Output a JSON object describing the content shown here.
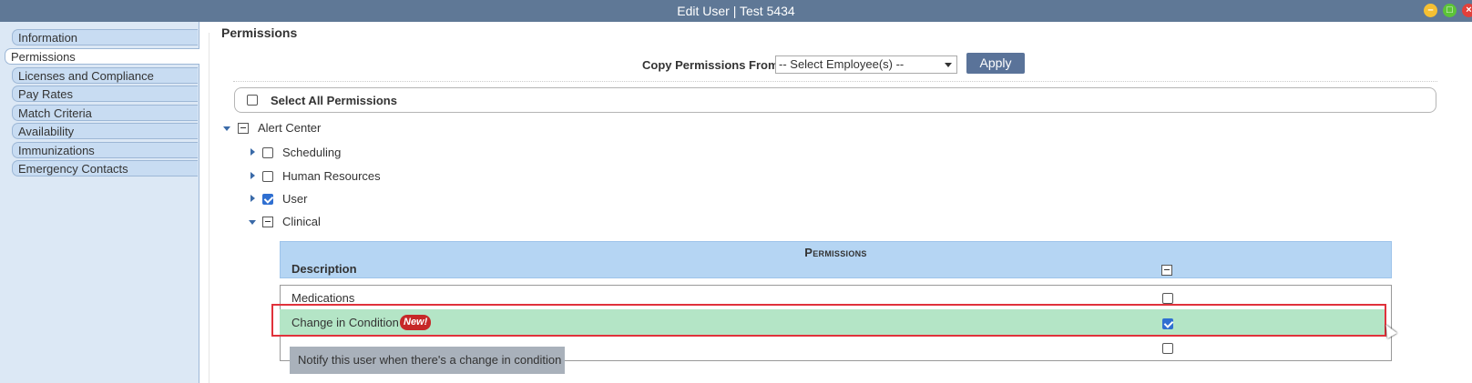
{
  "window": {
    "title": "Edit User | Test 5434"
  },
  "sidebar": {
    "items": [
      {
        "label": "Information"
      },
      {
        "label": "Permissions"
      },
      {
        "label": "Licenses and Compliance"
      },
      {
        "label": "Pay Rates"
      },
      {
        "label": "Match Criteria"
      },
      {
        "label": "Availability"
      },
      {
        "label": "Immunizations"
      },
      {
        "label": "Emergency Contacts"
      }
    ],
    "active": "Permissions"
  },
  "main": {
    "section_title": "Permissions",
    "copy": {
      "label": "Copy Permissions From",
      "select_value": "-- Select Employee(s) --",
      "apply_label": "Apply"
    },
    "select_all_label": "Select All Permissions",
    "tree": {
      "root": {
        "label": "Alert Center"
      },
      "children": [
        {
          "label": "Scheduling",
          "checked": false
        },
        {
          "label": "Human Resources",
          "checked": false
        },
        {
          "label": "User",
          "checked": true
        },
        {
          "label": "Clinical",
          "expanded": true
        }
      ]
    },
    "grid": {
      "title": "Permissions",
      "column_description": "Description",
      "rows": [
        {
          "label": "Medications",
          "checked": false
        },
        {
          "label": "Change in Condition",
          "checked": true,
          "badge": "New!"
        },
        {
          "label": "",
          "checked": false
        }
      ]
    },
    "tooltip": "Notify this user when there's a change in condition"
  },
  "colors": {
    "titlebar": "#5f7896",
    "highlight": "#b4e5c6",
    "highlight_border": "#e0323b",
    "apply_button": "#5a7399",
    "grid_header": "#b5d5f3"
  }
}
